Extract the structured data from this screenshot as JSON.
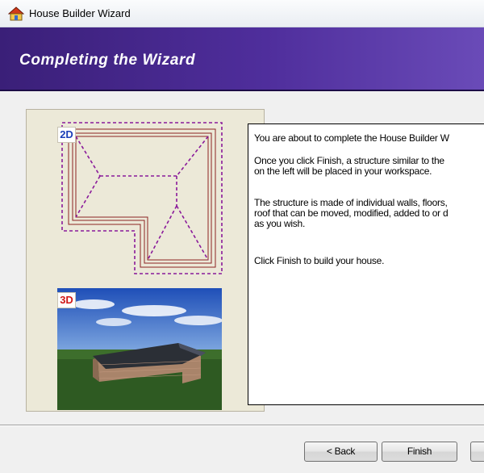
{
  "window": {
    "title": "House Builder Wizard"
  },
  "banner": {
    "title": "Completing the Wizard"
  },
  "preview": {
    "badge_2d": "2D",
    "badge_3d": "3D"
  },
  "content": {
    "paragraphs": [
      "You are about to complete the House Builder W",
      " Once you click Finish, a structure similar to the\non the left will be placed in your workspace.",
      "The structure is made of individual walls, floors,\nroof that can be moved, modified, added to or d\nas you wish.",
      "Click Finish to build your house."
    ]
  },
  "buttons": {
    "back": "< Back",
    "finish": "Finish",
    "cancel": ""
  },
  "colors": {
    "banner": "#4f2e9c",
    "plan_dash": "#8a1a9a",
    "plan_wall": "#8b2222",
    "panel": "#ece9d8"
  }
}
